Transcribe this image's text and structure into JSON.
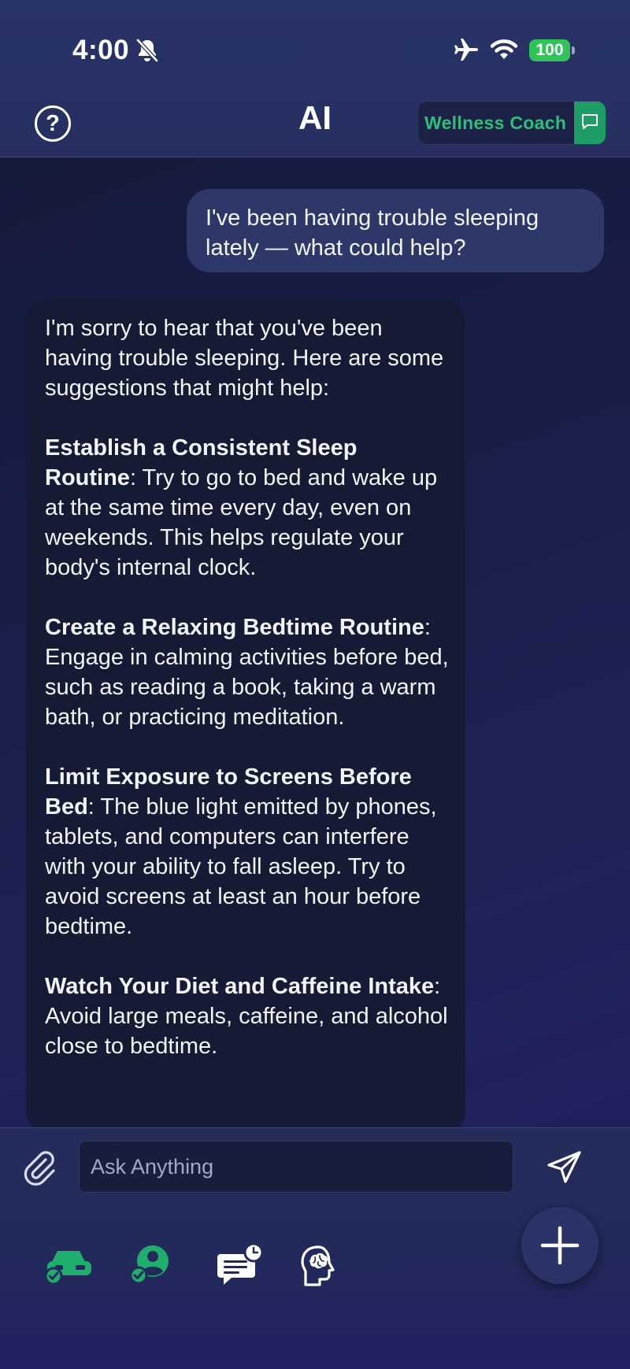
{
  "status_bar": {
    "time": "4:00",
    "battery": "100",
    "icons": [
      "bell-slash-icon",
      "airplane-icon",
      "wifi-icon",
      "battery-icon"
    ]
  },
  "header": {
    "help_label": "?",
    "title": "AI",
    "coach_label": "Wellness Coach",
    "coach_icon": "chat-bubble-icon"
  },
  "chat": {
    "user_message": "I've been having trouble sleeping lately — what could help?",
    "ai_intro": "I'm sorry to hear that you've been having trouble sleeping. Here are some suggestions that might help:",
    "tips": [
      {
        "title": "Establish a Consistent Sleep Routine",
        "body": ": Try to go to bed and wake up at the same time every day, even on weekends. This helps regulate your body's internal clock."
      },
      {
        "title": "Create a Relaxing Bedtime Routine",
        "body": ": Engage in calming activities before bed, such as reading a book, taking a warm bath, or practicing meditation."
      },
      {
        "title": "Limit Exposure to Screens Before Bed",
        "body": ": The blue light emitted by phones, tablets, and computers can interfere with your ability to fall asleep. Try to avoid screens at least an hour before bedtime."
      },
      {
        "title": "Watch Your Diet and Caffeine Intake",
        "body": ": Avoid large meals, caffeine, and alcohol close to bedtime."
      }
    ]
  },
  "composer": {
    "placeholder": "Ask Anything",
    "attach_icon": "paperclip-icon",
    "send_icon": "send-icon",
    "fab_icon": "plus-icon"
  },
  "bottom_nav": {
    "items": [
      "car-check-icon",
      "person-check-icon",
      "chat-clock-icon",
      "head-brain-icon"
    ]
  },
  "colors": {
    "accent_green": "#2dbe79",
    "battery_green": "#31c25a",
    "header_bg": "#283366"
  }
}
